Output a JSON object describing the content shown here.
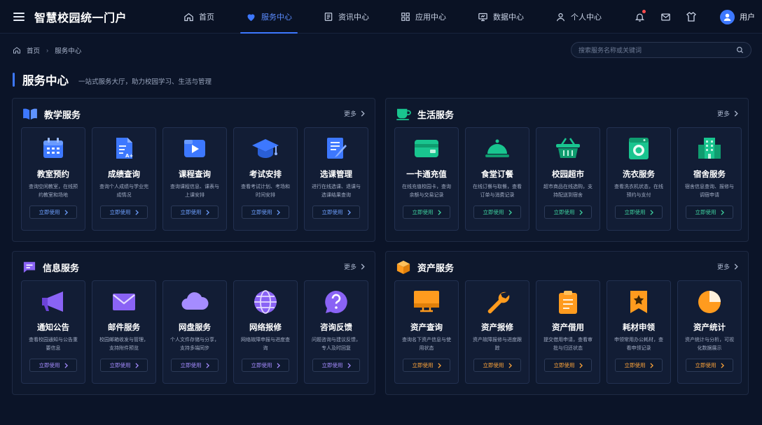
{
  "header": {
    "title": "智慧校园统一门户",
    "nav": [
      {
        "label": "首页",
        "icon": "home-icon"
      },
      {
        "label": "服务中心",
        "icon": "heart-icon",
        "active": true
      },
      {
        "label": "资讯中心",
        "icon": "document-icon"
      },
      {
        "label": "应用中心",
        "icon": "grid-icon"
      },
      {
        "label": "数据中心",
        "icon": "monitor-icon"
      },
      {
        "label": "个人中心",
        "icon": "user-icon"
      }
    ],
    "user_label": "用户"
  },
  "breadcrumb": {
    "home": "首页",
    "current": "服务中心"
  },
  "search": {
    "placeholder": "搜索服务名称或关键词"
  },
  "page": {
    "title": "服务中心",
    "subtitle": "一站式服务大厅，助力校园学习、生活与管理"
  },
  "more_label": "更多",
  "use_label": "立即使用",
  "colors": {
    "blue": "#3d78ff",
    "green": "#19c58f",
    "purple": "#8a63f5",
    "orange": "#ff9b1e"
  },
  "sections": {
    "teaching": {
      "title": "教学服务",
      "cards": [
        {
          "name": "教室预约",
          "desc": "查询空闲教室，在线预约教室和场地"
        },
        {
          "name": "成绩查询",
          "desc": "查询个人成绩与学业完成情况"
        },
        {
          "name": "课程查询",
          "desc": "查询课程信息、课表与上课安排"
        },
        {
          "name": "考试安排",
          "desc": "查看考试计划、考场和时间安排"
        },
        {
          "name": "选课管理",
          "desc": "进行在线选课、退课与选课结果查询"
        }
      ]
    },
    "life": {
      "title": "生活服务",
      "cards": [
        {
          "name": "一卡通充值",
          "desc": "在线充值校园卡，查询余额与交易记录"
        },
        {
          "name": "食堂订餐",
          "desc": "在线订餐与取餐，查看订单与消费记录"
        },
        {
          "name": "校园超市",
          "desc": "超市商品在线选购，支持配送到宿舍"
        },
        {
          "name": "洗衣服务",
          "desc": "查看洗衣机状态，在线预约与支付"
        },
        {
          "name": "宿舍服务",
          "desc": "宿舍信息查询、报修与调宿申请"
        }
      ]
    },
    "info": {
      "title": "信息服务",
      "cards": [
        {
          "name": "通知公告",
          "desc": "查看校园通知与公告重要信息"
        },
        {
          "name": "邮件服务",
          "desc": "校园邮箱收发与管理，支持附件预览"
        },
        {
          "name": "网盘服务",
          "desc": "个人文件存储与分享，支持多端同步"
        },
        {
          "name": "网络报修",
          "desc": "网络故障申报与进度查询"
        },
        {
          "name": "咨询反馈",
          "desc": "问题咨询与建议反馈，专人及时回复"
        }
      ]
    },
    "asset": {
      "title": "资产服务",
      "cards": [
        {
          "name": "资产查询",
          "desc": "查询名下资产信息与使用状态"
        },
        {
          "name": "资产报修",
          "desc": "资产故障报修与进度跟踪"
        },
        {
          "name": "资产借用",
          "desc": "提交借用申请，查看审批与归还状态"
        },
        {
          "name": "耗材申领",
          "desc": "申领常用办公耗材，查看申领记录"
        },
        {
          "name": "资产统计",
          "desc": "资产统计与分析，可视化数据展示"
        }
      ]
    }
  }
}
